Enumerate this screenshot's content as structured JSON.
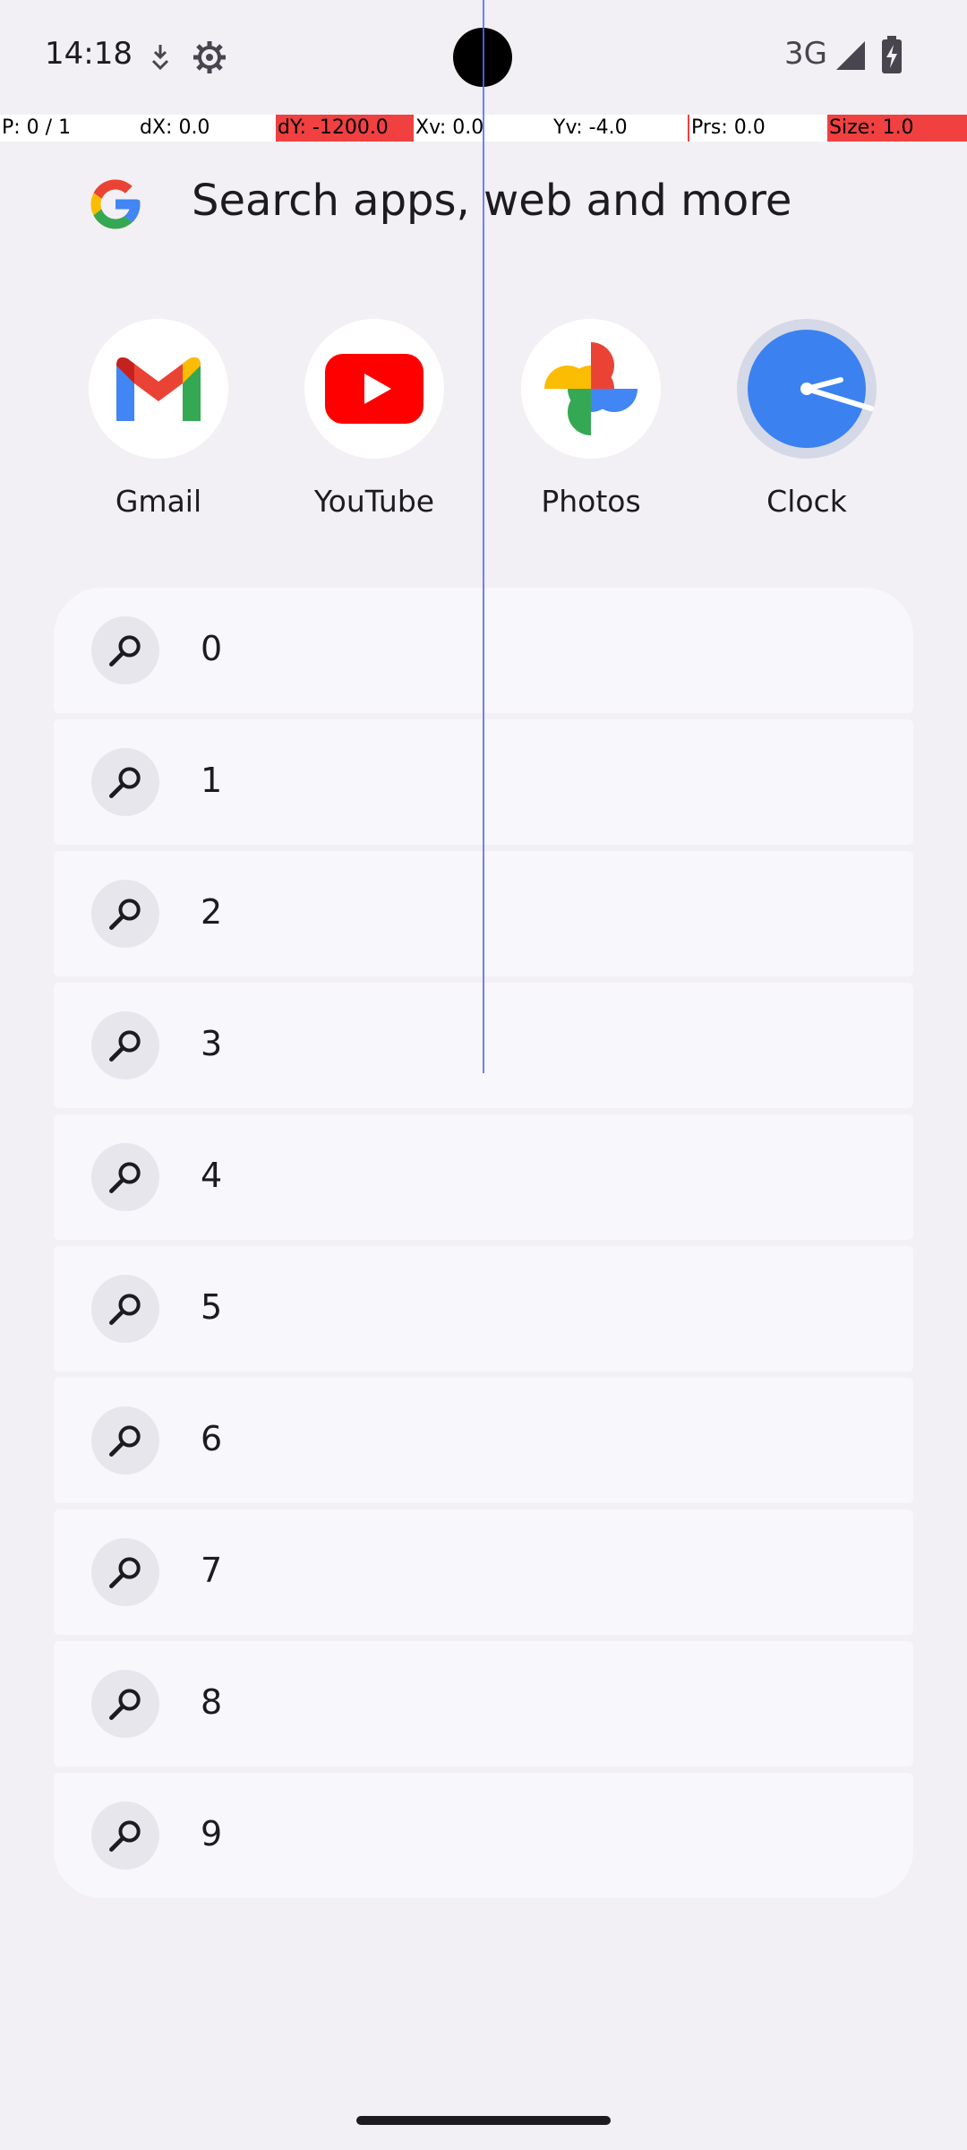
{
  "status_bar": {
    "time": "14:18",
    "network": "3G"
  },
  "pointer_location": {
    "p": "P: 0 / 1",
    "dx": "dX: 0.0",
    "dy": "dY: -1200.0",
    "xv": "Xv: 0.0",
    "yv": "Yv: -4.0",
    "prs": "Prs: 0.0",
    "size": "Size: 1.0"
  },
  "search": {
    "placeholder": "Search apps, web and more"
  },
  "apps": [
    {
      "label": "Gmail",
      "icon": "gmail-icon"
    },
    {
      "label": "YouTube",
      "icon": "youtube-icon"
    },
    {
      "label": "Photos",
      "icon": "photos-icon"
    },
    {
      "label": "Clock",
      "icon": "clock-icon"
    }
  ],
  "suggestions": [
    "0",
    "1",
    "2",
    "3",
    "4",
    "5",
    "6",
    "7",
    "8",
    "9"
  ],
  "colors": {
    "accent_blue": "#4285f4",
    "red": "#ea4335",
    "yellow": "#fbbc04",
    "green": "#34a853",
    "youtube_red": "#ff0000",
    "clock_blue": "#3b82f0"
  }
}
